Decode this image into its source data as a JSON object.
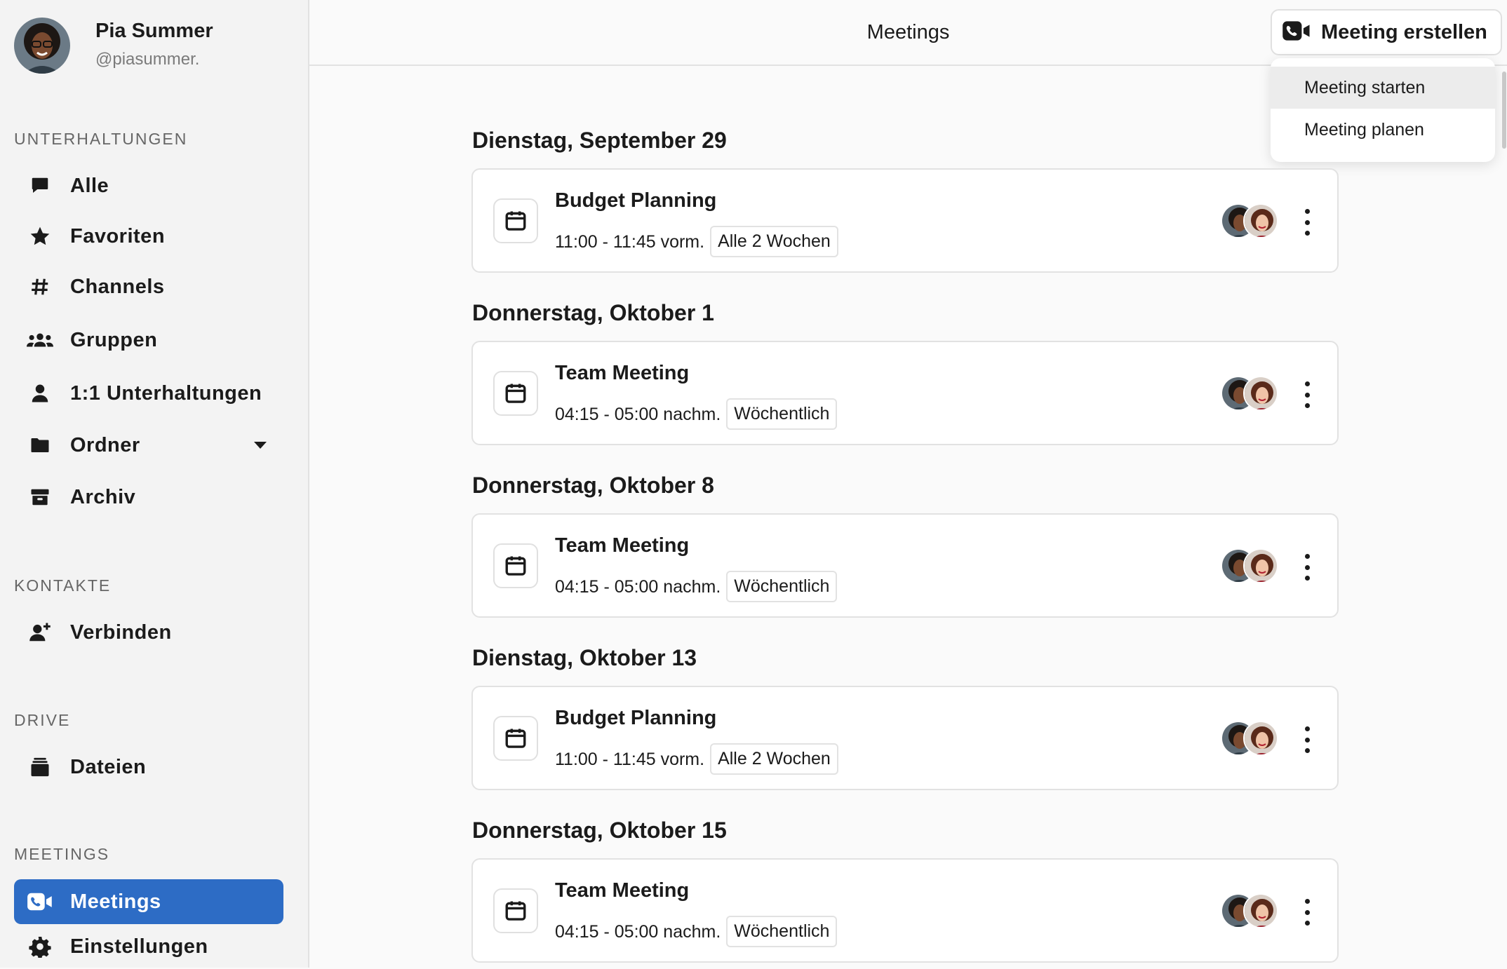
{
  "profile": {
    "name": "Pia Summer",
    "handle": "@piasummer."
  },
  "sidebar": {
    "sections": {
      "conversations": "UNTERHALTUNGEN",
      "contacts": "KONTAKTE",
      "drive": "DRIVE",
      "meetings": "MEETINGS"
    },
    "items": [
      {
        "label": "Alle",
        "icon": "chat-bubble-icon"
      },
      {
        "label": "Favoriten",
        "icon": "star-icon"
      },
      {
        "label": "Channels",
        "icon": "hash-icon"
      },
      {
        "label": "Gruppen",
        "icon": "group-icon"
      },
      {
        "label": "1:1 Unterhaltungen",
        "icon": "person-icon"
      },
      {
        "label": "Ordner",
        "icon": "folder-icon"
      },
      {
        "label": "Archiv",
        "icon": "archive-icon"
      },
      {
        "label": "Verbinden",
        "icon": "add-person-icon"
      },
      {
        "label": "Dateien",
        "icon": "files-icon"
      },
      {
        "label": "Meetings",
        "icon": "video-call-icon",
        "active": true
      },
      {
        "label": "Einstellungen",
        "icon": "gear-icon"
      }
    ]
  },
  "header": {
    "title": "Meetings",
    "create_button": "Meeting erstellen",
    "dropdown": [
      "Meeting starten",
      "Meeting planen"
    ]
  },
  "days": [
    {
      "heading": "Dienstag, September 29",
      "title": "Budget Planning",
      "time": "11:00 - 11:45 vorm.",
      "recurrence": "Alle 2 Wochen"
    },
    {
      "heading": "Donnerstag, Oktober 1",
      "title": "Team Meeting",
      "time": "04:15 - 05:00 nachm.",
      "recurrence": "Wöchentlich"
    },
    {
      "heading": "Donnerstag, Oktober 8",
      "title": "Team Meeting",
      "time": "04:15 - 05:00 nachm.",
      "recurrence": "Wöchentlich"
    },
    {
      "heading": "Dienstag, Oktober 13",
      "title": "Budget Planning",
      "time": "11:00 - 11:45 vorm.",
      "recurrence": "Alle 2 Wochen"
    },
    {
      "heading": "Donnerstag, Oktober 15",
      "title": "Team Meeting",
      "time": "04:15 - 05:00 nachm.",
      "recurrence": "Wöchentlich"
    }
  ],
  "colors": {
    "accent": "#2d6cc5",
    "sidebar_bg": "#f3f3f3"
  }
}
